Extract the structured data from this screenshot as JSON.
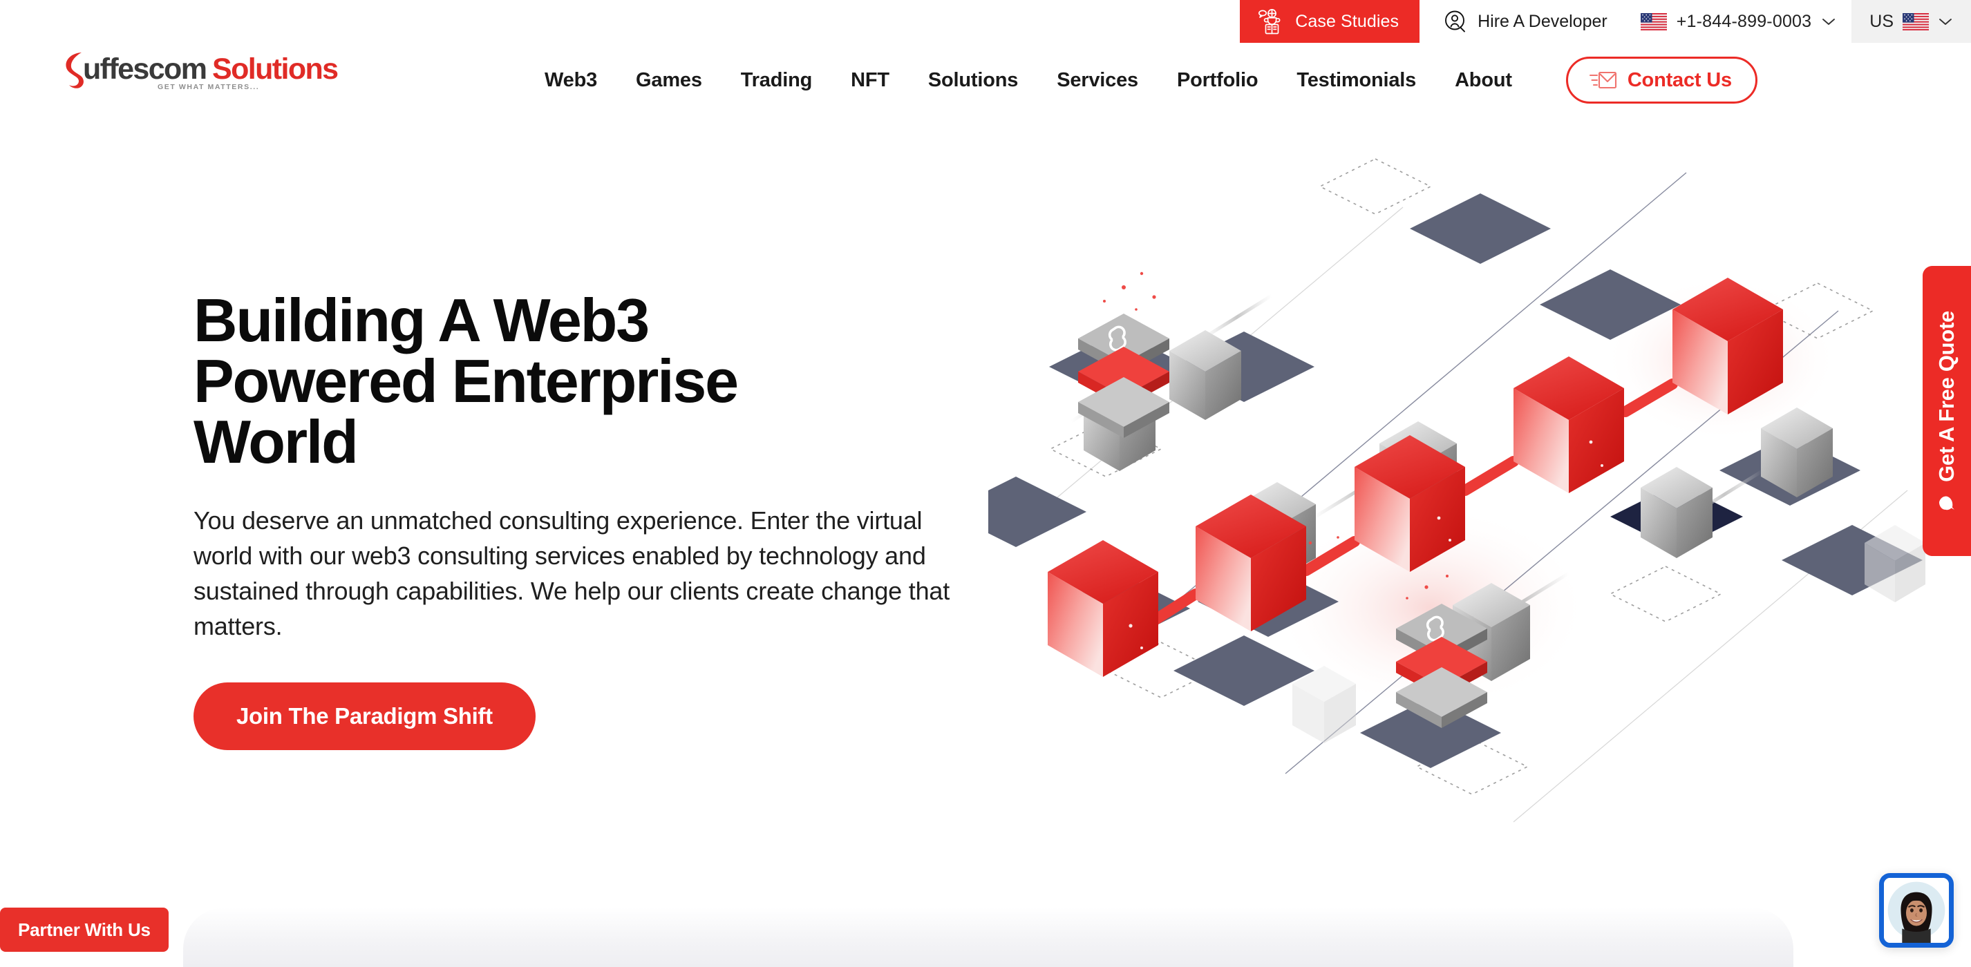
{
  "brand": {
    "logo_text_dark": "uffescom",
    "logo_text_red": "Solutions",
    "logo_initial": "S",
    "logo_tagline": "GET WHAT MATTERS...",
    "accent_red": "#EC2B26",
    "cta_red": "#E8302A",
    "dark_text": "#1a1a1a",
    "avatar_border_blue": "#1463D6",
    "illustration_slate": "#5E6377",
    "illustration_red": "#E8302A",
    "illustration_gray": "#9a9a9a"
  },
  "topbar": {
    "case_studies_label": "Case Studies",
    "case_studies_icon": "trophy-book-icon",
    "hire_developer_label": "Hire A Developer",
    "hire_developer_icon": "person-circle-icon",
    "phone_number": "+1-844-899-0003",
    "phone_flag_icon": "us-flag-icon",
    "phone_chevron_icon": "chevron-down-icon",
    "country_code": "US",
    "country_flag_icon": "us-flag-icon",
    "country_chevron_icon": "chevron-down-icon"
  },
  "nav": {
    "items": [
      {
        "label": "Web3"
      },
      {
        "label": "Games"
      },
      {
        "label": "Trading"
      },
      {
        "label": "NFT"
      },
      {
        "label": "Solutions"
      },
      {
        "label": "Services"
      },
      {
        "label": "Portfolio"
      },
      {
        "label": "Testimonials"
      },
      {
        "label": "About"
      }
    ],
    "contact_label": "Contact Us",
    "contact_icon": "envelope-send-icon"
  },
  "hero": {
    "title": "Building A Web3\nPowered Enterprise\nWorld",
    "subtitle": "You deserve an unmatched consulting experience. Enter the virtual world with our web3 consulting services enabled by technology and sustained through capabilities. We help our clients create change that matters.",
    "cta_label": "Join The Paradigm Shift",
    "illustration_name": "isometric-blockchain-illustration"
  },
  "floating": {
    "quote_tab_label": "Get A Free Quote",
    "quote_tab_icon": "chat-bubble-icon",
    "partner_label": "Partner With Us",
    "chat_avatar_icon": "support-agent-avatar"
  }
}
